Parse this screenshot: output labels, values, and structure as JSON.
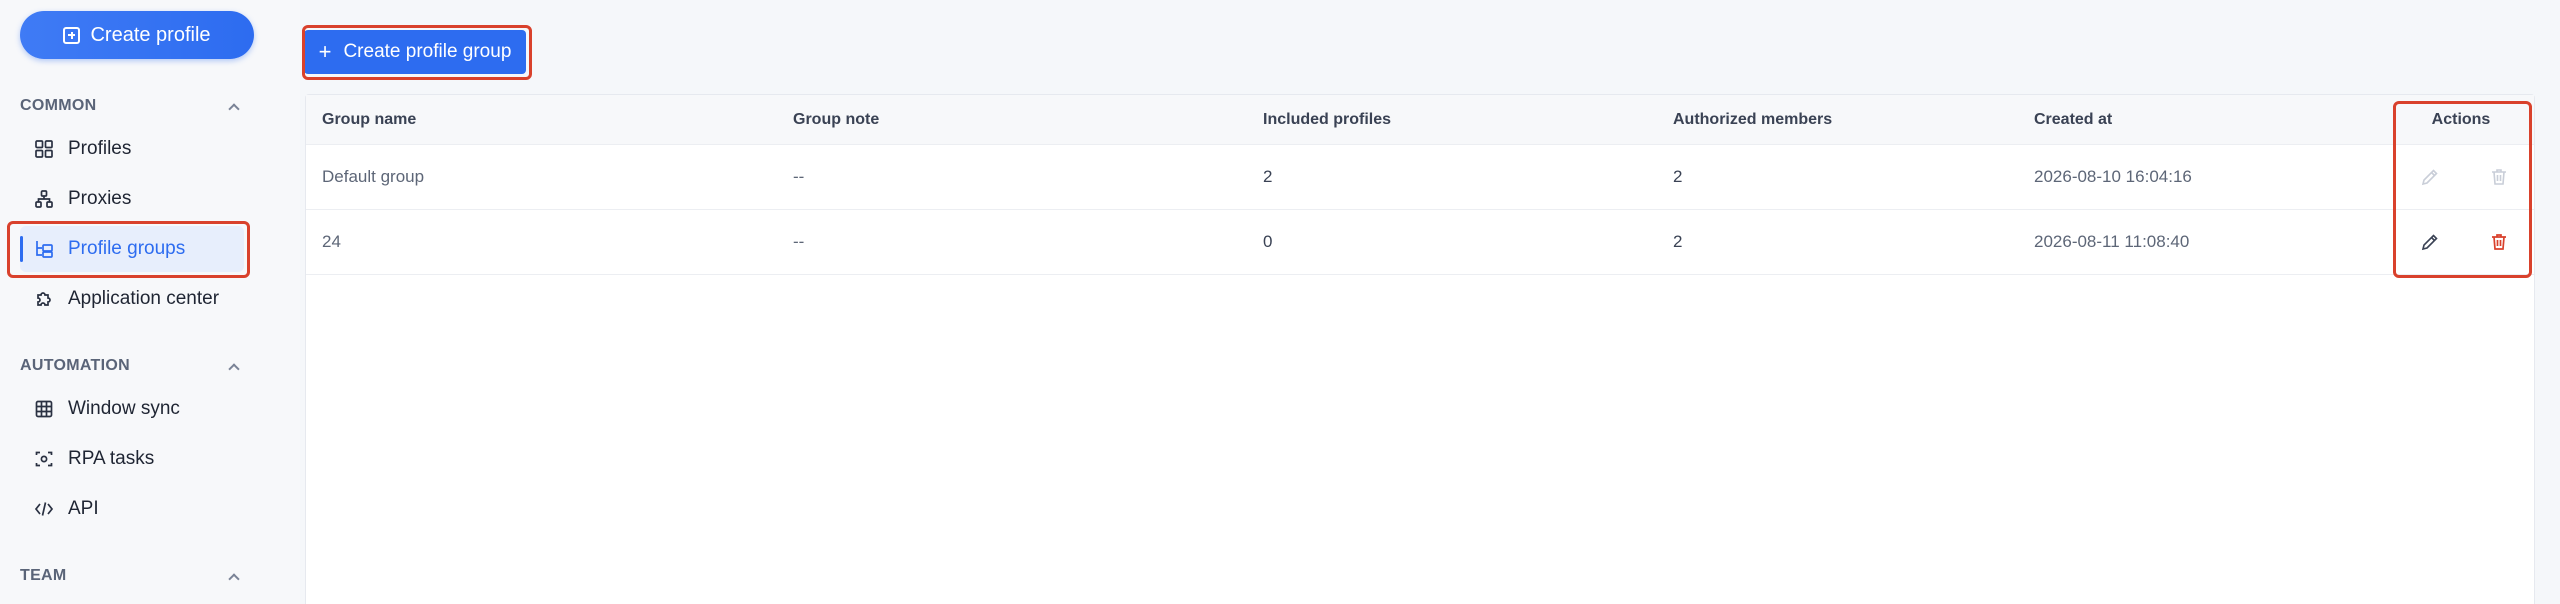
{
  "sidebar": {
    "create_profile_label": "Create profile",
    "sections": {
      "common": "COMMON",
      "automation": "AUTOMATION",
      "team": "TEAM"
    },
    "items": {
      "profiles": "Profiles",
      "proxies": "Proxies",
      "profile_groups": "Profile groups",
      "application_center": "Application center",
      "window_sync": "Window sync",
      "rpa_tasks": "RPA tasks",
      "api": "API"
    }
  },
  "main": {
    "create_group_label": "Create profile group",
    "table": {
      "headers": {
        "group_name": "Group name",
        "group_note": "Group note",
        "included_profiles": "Included profiles",
        "authorized_members": "Authorized members",
        "created_at": "Created at",
        "actions": "Actions"
      },
      "rows": [
        {
          "group_name": "Default group",
          "group_note": "--",
          "included_profiles": "2",
          "authorized_members": "2",
          "created_at": "2026-08-10 16:04:16",
          "actions_enabled": false
        },
        {
          "group_name": "24",
          "group_note": "--",
          "included_profiles": "0",
          "authorized_members": "2",
          "created_at": "2026-08-11 11:08:40",
          "actions_enabled": true
        }
      ]
    }
  },
  "colors": {
    "accent": "#2d6cf0",
    "highlight_outline": "#d9412c",
    "delete_red": "#d9412c",
    "disabled_icon": "#c9ced8"
  }
}
